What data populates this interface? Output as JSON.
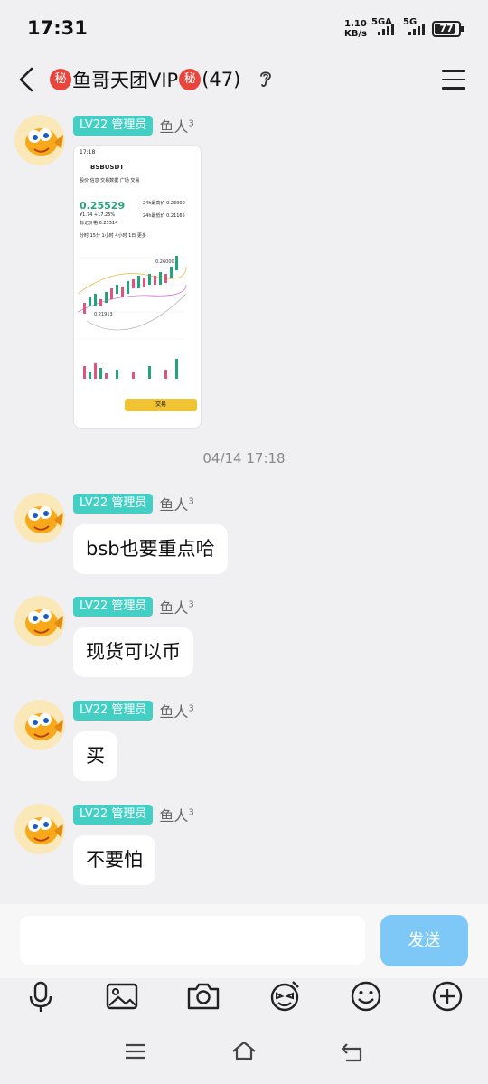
{
  "status": {
    "time": "17:31",
    "net_speed": "1.10",
    "net_unit": "KB/s",
    "sig1": "5GA",
    "sig2": "5G",
    "battery": "77"
  },
  "header": {
    "secret_glyph": "秘",
    "title": "鱼哥天团VIP",
    "count": "(47)"
  },
  "messages": [
    {
      "badge": "LV22 管理员",
      "sender": "鱼人",
      "sender_sup": "3"
    },
    {
      "badge": "LV22 管理员",
      "sender": "鱼人",
      "sender_sup": "3",
      "text": "bsb也要重点哈"
    },
    {
      "badge": "LV22 管理员",
      "sender": "鱼人",
      "sender_sup": "3",
      "text": "现货可以币"
    },
    {
      "badge": "LV22 管理员",
      "sender": "鱼人",
      "sender_sup": "3",
      "text": "买"
    },
    {
      "badge": "LV22 管理员",
      "sender": "鱼人",
      "sender_sup": "3",
      "text": "不要怕"
    }
  ],
  "screenshot_thumb": {
    "time": "17:18",
    "pair": "BSBUSDT",
    "tabs": "股价   信息   交易数据   广场   交易",
    "price": "0.25529",
    "sub1": "¥1.74  +17.25%",
    "sub2": "标记价格 0.25514",
    "stat_a": "24h最高价 0.26000",
    "stat_b": "24h最低价 0.21165",
    "periods": "分时  15分  1小时  4小时  1日  更多",
    "label_high": "0.26000",
    "label_low": "0.21913",
    "trade_label": "交易"
  },
  "timestamp": "04/14 17:18",
  "input": {
    "send_label": "发送"
  },
  "tools": [
    "mic-icon",
    "image-icon",
    "camera-icon",
    "sticker-icon",
    "emoji-icon",
    "plus-icon"
  ]
}
